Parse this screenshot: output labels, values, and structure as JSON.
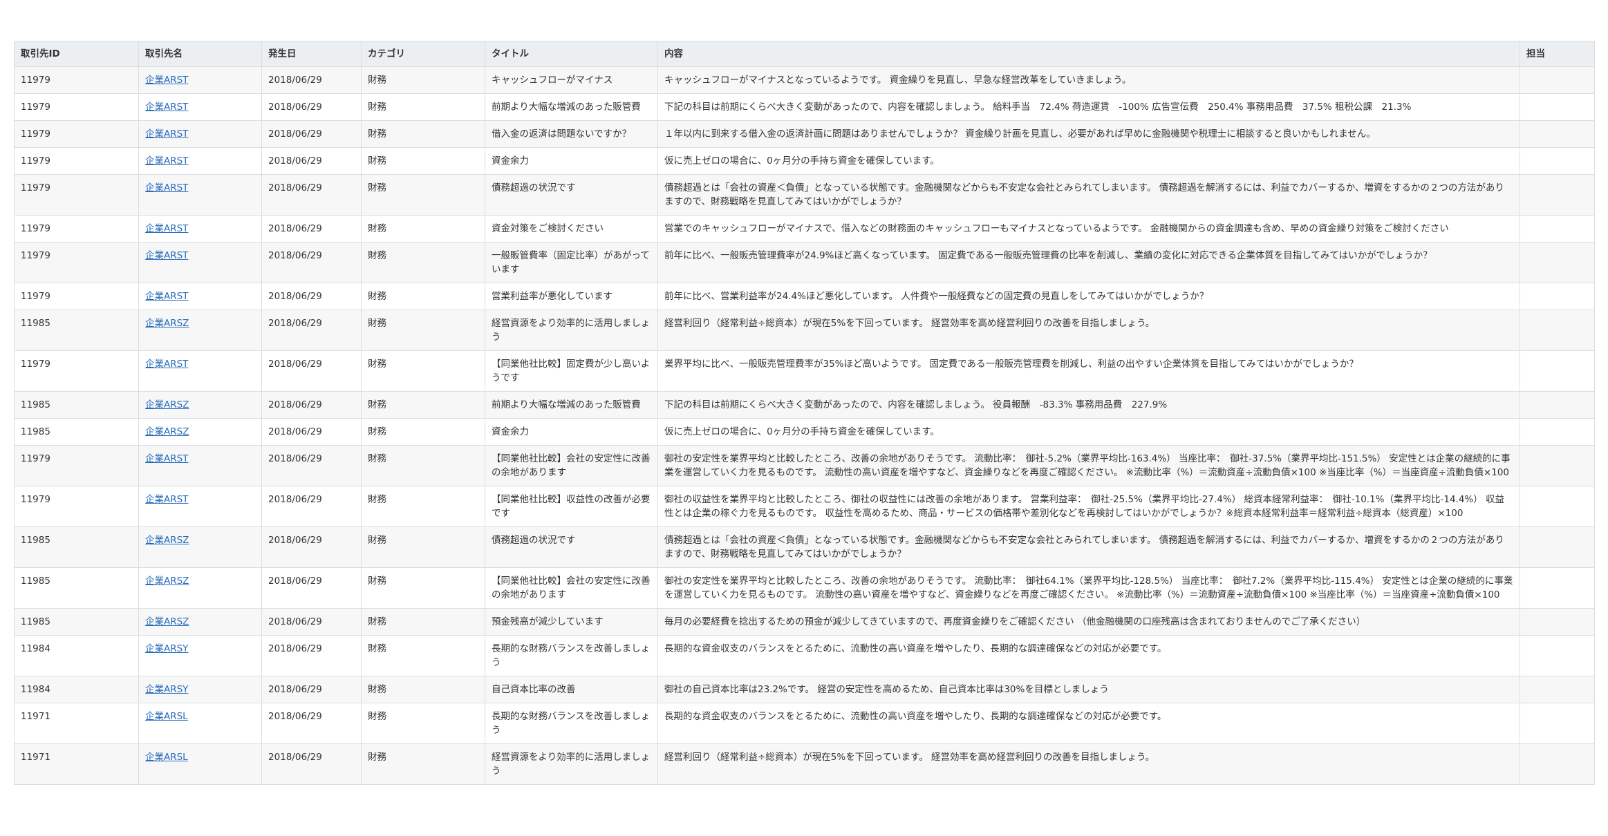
{
  "table": {
    "headers": [
      "取引先ID",
      "取引先名",
      "発生日",
      "カテゴリ",
      "タイトル",
      "内容",
      "担当"
    ],
    "rows": [
      {
        "id": "11979",
        "company": "企業ARST",
        "date": "2018/06/29",
        "category": "財務",
        "title": "キャッシュフローがマイナス",
        "content": "キャッシュフローがマイナスとなっているようです。 資金繰りを見直し、早急な経営改革をしていきましょう。",
        "assignee": ""
      },
      {
        "id": "11979",
        "company": "企業ARST",
        "date": "2018/06/29",
        "category": "財務",
        "title": "前期より大幅な増減のあった販管費",
        "content": "下記の科目は前期にくらべ大きく変動があったので、内容を確認しましょう。 給料手当　72.4% 荷造運賃　-100% 広告宣伝費　250.4% 事務用品費　37.5% 租税公課　21.3%",
        "assignee": ""
      },
      {
        "id": "11979",
        "company": "企業ARST",
        "date": "2018/06/29",
        "category": "財務",
        "title": "借入金の返済は問題ないですか？",
        "content": "１年以内に到来する借入金の返済計画に問題はありませんでしょうか？ 資金繰り計画を見直し、必要があれば早めに金融機関や税理士に相談すると良いかもしれません。",
        "assignee": ""
      },
      {
        "id": "11979",
        "company": "企業ARST",
        "date": "2018/06/29",
        "category": "財務",
        "title": "資金余力",
        "content": "仮に売上ゼロの場合に、0ヶ月分の手持ち資金を確保しています。",
        "assignee": ""
      },
      {
        "id": "11979",
        "company": "企業ARST",
        "date": "2018/06/29",
        "category": "財務",
        "title": "債務超過の状況です",
        "content": "債務超過とは「会社の資産＜負債」となっている状態です。金融機関などからも不安定な会社とみられてしまいます。 債務超過を解消するには、利益でカバーするか、増資をするかの２つの方法がありますので、財務戦略を見直してみてはいかがでしょうか？",
        "assignee": ""
      },
      {
        "id": "11979",
        "company": "企業ARST",
        "date": "2018/06/29",
        "category": "財務",
        "title": "資金対策をご検討ください",
        "content": "営業でのキャッシュフローがマイナスで、借入などの財務面のキャッシュフローもマイナスとなっているようです。 金融機関からの資金調達も含め、早めの資金繰り対策をご検討ください",
        "assignee": ""
      },
      {
        "id": "11979",
        "company": "企業ARST",
        "date": "2018/06/29",
        "category": "財務",
        "title": "一般販管費率（固定比率）があがっています",
        "content": "前年に比べ、一般販売管理費率が24.9%ほど高くなっています。 固定費である一般販売管理費の比率を削減し、業績の変化に対応できる企業体質を目指してみてはいかがでしょうか？",
        "assignee": ""
      },
      {
        "id": "11979",
        "company": "企業ARST",
        "date": "2018/06/29",
        "category": "財務",
        "title": "営業利益率が悪化しています",
        "content": "前年に比べ、営業利益率が24.4%ほど悪化しています。 人件費や一般経費などの固定費の見直しをしてみてはいかがでしょうか？",
        "assignee": ""
      },
      {
        "id": "11985",
        "company": "企業ARSZ",
        "date": "2018/06/29",
        "category": "財務",
        "title": "経営資源をより効率的に活用しましょう",
        "content": "経営利回り（経常利益÷総資本）が現在5%を下回っています。 経営効率を高め経営利回りの改善を目指しましょう。",
        "assignee": ""
      },
      {
        "id": "11979",
        "company": "企業ARST",
        "date": "2018/06/29",
        "category": "財務",
        "title": "【同業他社比較】固定費が少し高いようです",
        "content": "業界平均に比べ、一般販売管理費率が35%ほど高いようです。 固定費である一般販売管理費を削減し、利益の出やすい企業体質を目指してみてはいかがでしょうか？",
        "assignee": ""
      },
      {
        "id": "11985",
        "company": "企業ARSZ",
        "date": "2018/06/29",
        "category": "財務",
        "title": "前期より大幅な増減のあった販管費",
        "content": "下記の科目は前期にくらべ大きく変動があったので、内容を確認しましょう。 役員報酬　-83.3% 事務用品費　227.9%",
        "assignee": ""
      },
      {
        "id": "11985",
        "company": "企業ARSZ",
        "date": "2018/06/29",
        "category": "財務",
        "title": "資金余力",
        "content": "仮に売上ゼロの場合に、0ヶ月分の手持ち資金を確保しています。",
        "assignee": ""
      },
      {
        "id": "11979",
        "company": "企業ARST",
        "date": "2018/06/29",
        "category": "財務",
        "title": "【同業他社比較】会社の安定性に改善の余地があります",
        "content": "御社の安定性を業界平均と比較したところ、改善の余地がありそうです。 流動比率：　御社-5.2%（業界平均比-163.4%） 当座比率：　御社-37.5%（業界平均比-151.5%） 安定性とは企業の継続的に事業を運営していく力を見るものです。 流動性の高い資産を増やすなど、資金繰りなどを再度ご確認ください。 ※流動比率（%）＝流動資産÷流動負債×100 ※当座比率（%）＝当座資産÷流動負債×100",
        "assignee": ""
      },
      {
        "id": "11979",
        "company": "企業ARST",
        "date": "2018/06/29",
        "category": "財務",
        "title": "【同業他社比較】収益性の改善が必要です",
        "content": "御社の収益性を業界平均と比較したところ、御社の収益性には改善の余地があります。 営業利益率：　御社-25.5%（業界平均比-27.4%） 総資本経常利益率：　御社-10.1%（業界平均比-14.4%） 収益性とは企業の稼ぐ力を見るものです。 収益性を高めるため、商品・サービスの価格帯や差別化などを再検討してはいかがでしょうか？※総資本経常利益率＝経常利益÷総資本（総資産）×100",
        "assignee": ""
      },
      {
        "id": "11985",
        "company": "企業ARSZ",
        "date": "2018/06/29",
        "category": "財務",
        "title": "債務超過の状況です",
        "content": "債務超過とは「会社の資産＜負債」となっている状態です。金融機関などからも不安定な会社とみられてしまいます。 債務超過を解消するには、利益でカバーするか、増資をするかの２つの方法がありますので、財務戦略を見直してみてはいかがでしょうか？",
        "assignee": ""
      },
      {
        "id": "11985",
        "company": "企業ARSZ",
        "date": "2018/06/29",
        "category": "財務",
        "title": "【同業他社比較】会社の安定性に改善の余地があります",
        "content": "御社の安定性を業界平均と比較したところ、改善の余地がありそうです。 流動比率：　御社64.1%（業界平均比-128.5%） 当座比率：　御社7.2%（業界平均比-115.4%） 安定性とは企業の継続的に事業を運営していく力を見るものです。 流動性の高い資産を増やすなど、資金繰りなどを再度ご確認ください。 ※流動比率（%）＝流動資産÷流動負債×100 ※当座比率（%）＝当座資産÷流動負債×100",
        "assignee": ""
      },
      {
        "id": "11985",
        "company": "企業ARSZ",
        "date": "2018/06/29",
        "category": "財務",
        "title": "預金残高が減少しています",
        "content": "毎月の必要経費を捻出するための預金が減少してきていますので、再度資金繰りをご確認ください （他金融機関の口座残高は含まれておりませんのでご了承ください）",
        "assignee": ""
      },
      {
        "id": "11984",
        "company": "企業ARSY",
        "date": "2018/06/29",
        "category": "財務",
        "title": "長期的な財務バランスを改善しましょう",
        "content": "長期的な資金収支のバランスをとるために、流動性の高い資産を増やしたり、長期的な調達確保などの対応が必要です。",
        "assignee": ""
      },
      {
        "id": "11984",
        "company": "企業ARSY",
        "date": "2018/06/29",
        "category": "財務",
        "title": "自己資本比率の改善",
        "content": "御社の自己資本比率は23.2%です。 経営の安定性を高めるため、自己資本比率は30%を目標としましょう",
        "assignee": ""
      },
      {
        "id": "11971",
        "company": "企業ARSL",
        "date": "2018/06/29",
        "category": "財務",
        "title": "長期的な財務バランスを改善しましょう",
        "content": "長期的な資金収支のバランスをとるために、流動性の高い資産を増やしたり、長期的な調達確保などの対応が必要です。",
        "assignee": ""
      },
      {
        "id": "11971",
        "company": "企業ARSL",
        "date": "2018/06/29",
        "category": "財務",
        "title": "経営資源をより効率的に活用しましょう",
        "content": "経営利回り（経常利益÷総資本）が現在5%を下回っています。 経営効率を高め経営利回りの改善を目指しましょう。",
        "assignee": ""
      }
    ]
  }
}
